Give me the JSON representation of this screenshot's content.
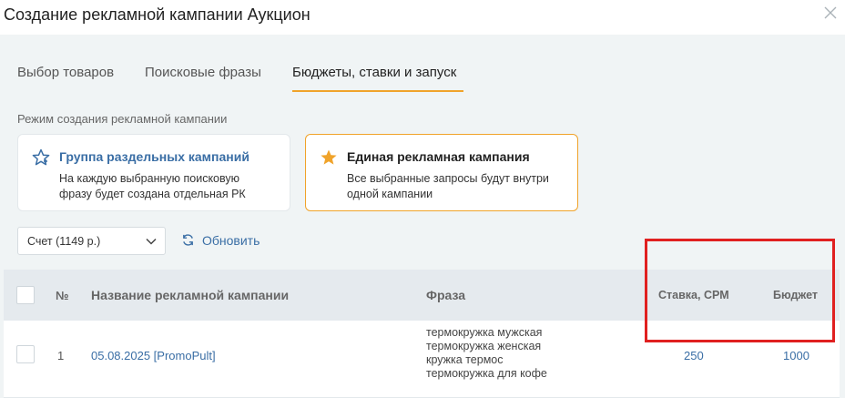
{
  "window": {
    "title": "Создание рекламной кампании Аукцион"
  },
  "tabs": [
    {
      "label": "Выбор товаров"
    },
    {
      "label": "Поисковые фразы"
    },
    {
      "label": "Бюджеты, ставки и запуск",
      "active": true
    }
  ],
  "mode": {
    "label": "Режим создания рекламной кампании",
    "cards": [
      {
        "title": "Группа раздельных кампаний",
        "desc_line1": "На каждую выбранную поисковую",
        "desc_line2": "фразу будет создана отдельная РК",
        "icon": "star-outline-icon",
        "selected": false
      },
      {
        "title": "Единая рекламная кампания",
        "desc_line1": "Все выбранные запросы будут внутри",
        "desc_line2": "одной кампании",
        "icon": "star-filled-icon",
        "selected": true
      }
    ]
  },
  "account": {
    "selected": "Счет (1149 р.)"
  },
  "refresh": {
    "label": "Обновить"
  },
  "table": {
    "headers": {
      "num": "№",
      "name": "Название рекламной кампании",
      "phrase": "Фраза",
      "rate": "Ставка, CPM",
      "budget": "Бюджет"
    },
    "rows": [
      {
        "num": "1",
        "name": "05.08.2025 [PromoPult]",
        "phrases": [
          "термокружка мужская",
          "термокружка женская",
          "кружка термос",
          "термокружка для кофе"
        ],
        "rate": "250",
        "budget": "1000"
      }
    ]
  },
  "colors": {
    "accent": "#f0a32a",
    "link": "#3a6ea5",
    "highlight": "#e02020"
  }
}
